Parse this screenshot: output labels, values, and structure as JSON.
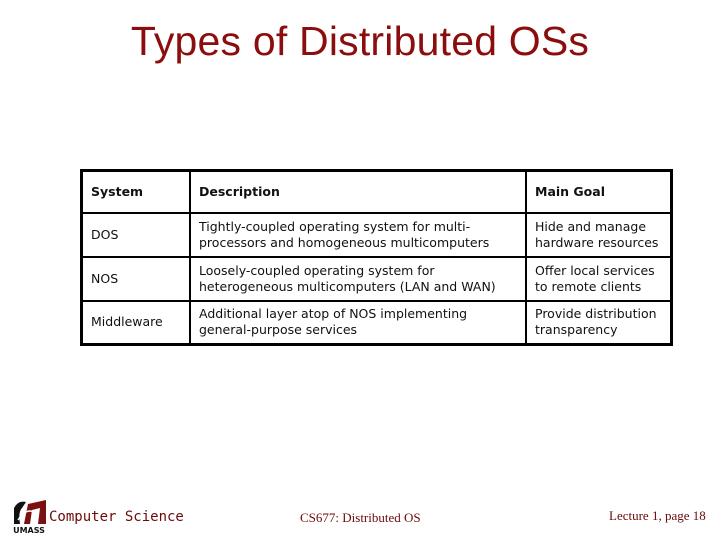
{
  "slide": {
    "title": "Types of Distributed OSs"
  },
  "table": {
    "headers": [
      "System",
      "Description",
      "Main Goal"
    ],
    "rows": [
      {
        "system": "DOS",
        "description": "Tightly-coupled operating system for multi-processors and homogeneous multicomputers",
        "goal": "Hide and manage hardware resources"
      },
      {
        "system": "NOS",
        "description": "Loosely-coupled operating system for heterogeneous multicomputers (LAN and WAN)",
        "goal": "Offer local services to remote clients"
      },
      {
        "system": "Middleware",
        "description": "Additional layer atop of NOS implementing general-purpose services",
        "goal": "Provide distribution transparency"
      }
    ]
  },
  "footer": {
    "logo_icon": "umass-logo-icon",
    "logo_text": "UMASS",
    "department": "Computer Science",
    "course": "CS677: Distributed OS",
    "page": "Lecture 1, page 18"
  },
  "colors": {
    "title": "#8b0d0d",
    "footer_text": "#6b0a0a",
    "logo_maroon": "#7a1010"
  }
}
